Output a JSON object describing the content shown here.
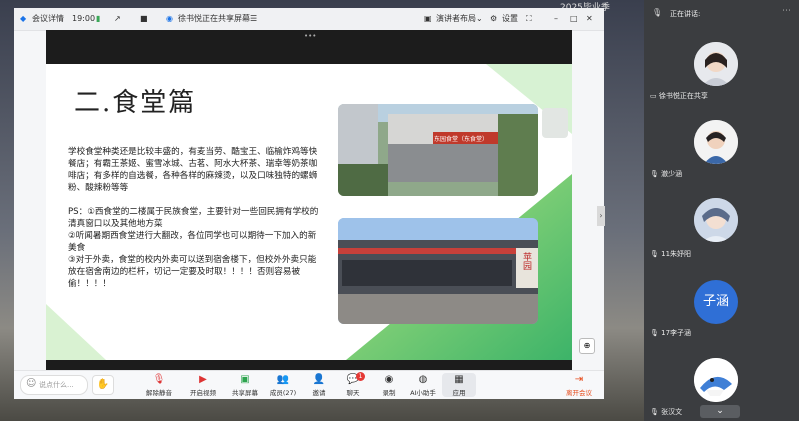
{
  "desktop": {
    "top_text": "2025毕业季"
  },
  "titlebar": {
    "meeting_details": "会议详情",
    "time": "19:00",
    "sharing_status": "徐书悦正在共享屏幕",
    "layout_label": "演讲者布局",
    "settings_label": "设置"
  },
  "slide": {
    "title": "二.食堂篇",
    "para1": "学校食堂种类还是比较丰盛的，有麦当劳、酷宝王、临榆炸鸡等快餐店；有霸王茶姬、蜜雪冰城、古茗、阿水大杯茶、瑞幸等奶茶咖啡店；有多样的自选餐，各种各样的麻辣烫，以及口味独特的螺蛳粉、酸辣粉等等",
    "ps1": "PS：①西食堂的二楼属于民族食堂，主要针对一些回民拥有学校的清真窗口以及其他地方菜",
    "ps2": "②听闻暑期西食堂进行大翻改，各位同学也可以期待一下加入的新美食",
    "ps3": "③对于外卖，食堂的校内外卖可以送到宿舍楼下，但校外外卖只能放在宿舍南边的栏杆，切记一定要及时取！！！！否则容易被偷！！！！",
    "sign1": "东园食堂（东食堂）",
    "sign2": "苹园"
  },
  "toolbar": {
    "chat_placeholder": "说点什么...",
    "unmute": "解除静音",
    "video": "开启视频",
    "share": "共享屏幕",
    "members": "成员(27)",
    "invite": "邀请",
    "chat": "聊天",
    "chat_badge": "1",
    "record": "录制",
    "ai": "AI小助手",
    "apps": "应用",
    "leave": "离开会议"
  },
  "panel": {
    "speaking_label": "正在讲话:",
    "participants": [
      {
        "name": "徐书悦正在共享"
      },
      {
        "name": "澈少涵"
      },
      {
        "name": "11朱妤阳"
      },
      {
        "name": "17李子涵",
        "avatar_text": "子涵"
      },
      {
        "name": "张汉文"
      }
    ]
  },
  "colors": {
    "accent": "#1a73e8",
    "leave": "#e64a19",
    "avatar_blue": "#2f6fd6"
  }
}
